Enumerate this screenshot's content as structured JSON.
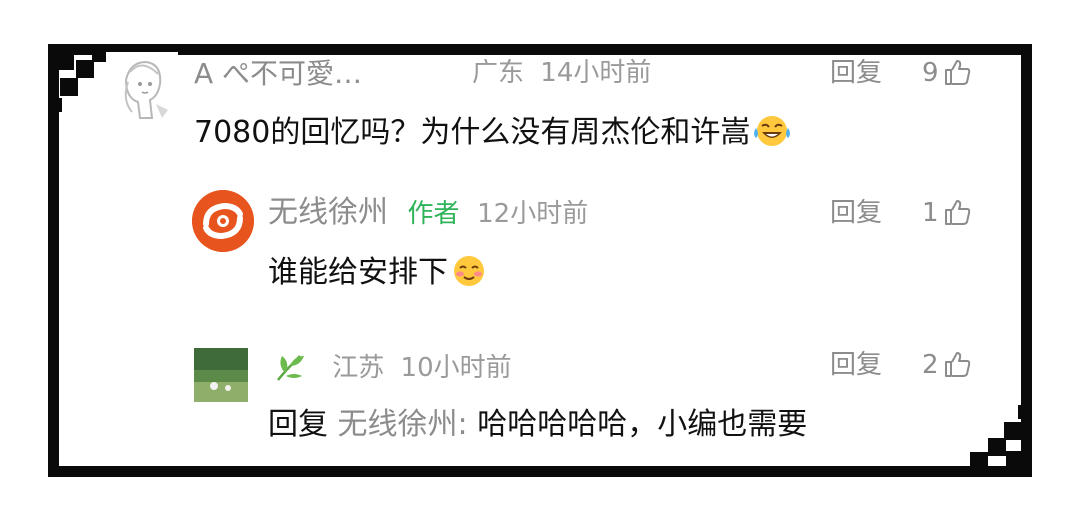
{
  "comments": [
    {
      "user": "A  ぺ不可愛…",
      "location": "广东",
      "time": "14小时前",
      "reply_label": "回复",
      "like_count": "9",
      "text": "7080的回忆吗？为什么没有周杰伦和许嵩",
      "emoji": "laughing-tears"
    },
    {
      "user": "无线徐州",
      "badge": "作者",
      "time": "12小时前",
      "reply_label": "回复",
      "like_count": "1",
      "text": "谁能给安排下",
      "emoji": "smiling-blush"
    },
    {
      "location": "江苏",
      "time": "10小时前",
      "reply_label": "回复",
      "like_count": "2",
      "reply_prefix": "回复",
      "reply_to": "无线徐州:",
      "text": "哈哈哈哈哈，小编也需要"
    }
  ],
  "colors": {
    "frame": "#0a0a0a",
    "author_badge": "#2fb45a",
    "muted_text": "#8c8c8c",
    "avatar_brand": "#e8541e"
  },
  "icons": [
    "thumbs-up-icon",
    "leaf-icon"
  ]
}
